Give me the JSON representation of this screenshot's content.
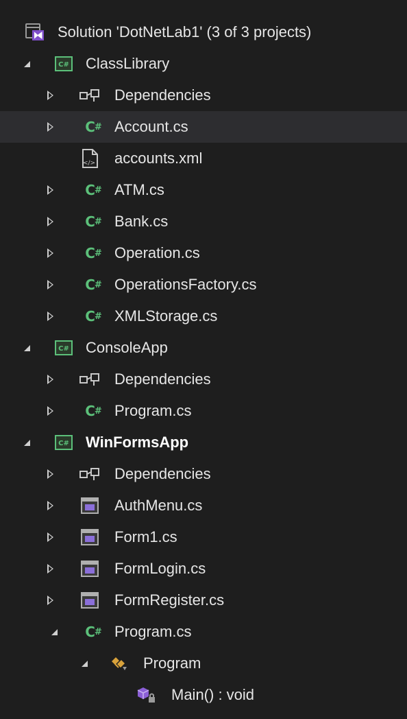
{
  "solution": {
    "label": "Solution 'DotNetLab1' (3 of 3 projects)",
    "icon": "solution-icon"
  },
  "projects": [
    {
      "name": "ClassLibrary",
      "icon": "csharp-project-icon",
      "items": [
        {
          "label": "Dependencies",
          "icon": "dependencies-icon"
        },
        {
          "label": "Account.cs",
          "icon": "csharp-file-icon",
          "selected": true
        },
        {
          "label": "accounts.xml",
          "icon": "xml-file-icon"
        },
        {
          "label": "ATM.cs",
          "icon": "csharp-file-icon"
        },
        {
          "label": "Bank.cs",
          "icon": "csharp-file-icon"
        },
        {
          "label": "Operation.cs",
          "icon": "csharp-file-icon"
        },
        {
          "label": "OperationsFactory.cs",
          "icon": "csharp-file-icon"
        },
        {
          "label": "XMLStorage.cs",
          "icon": "csharp-file-icon"
        }
      ]
    },
    {
      "name": "ConsoleApp",
      "icon": "csharp-project-icon",
      "items": [
        {
          "label": "Dependencies",
          "icon": "dependencies-icon"
        },
        {
          "label": "Program.cs",
          "icon": "csharp-file-icon"
        }
      ]
    },
    {
      "name": "WinFormsApp",
      "icon": "csharp-project-icon",
      "bold": true,
      "items": [
        {
          "label": "Dependencies",
          "icon": "dependencies-icon"
        },
        {
          "label": "AuthMenu.cs",
          "icon": "form-file-icon"
        },
        {
          "label": "Form1.cs",
          "icon": "form-file-icon"
        },
        {
          "label": "FormLogin.cs",
          "icon": "form-file-icon"
        },
        {
          "label": "FormRegister.cs",
          "icon": "form-file-icon"
        },
        {
          "label": "Program.cs",
          "icon": "csharp-file-icon"
        },
        {
          "label": "Program",
          "icon": "class-icon"
        },
        {
          "label": "Main() : void",
          "icon": "method-icon"
        }
      ]
    }
  ],
  "csharp_glyph": "C#",
  "project_glyph": "C#",
  "colors": {
    "background": "#1e1e1e",
    "selected_row": "#2d2d30",
    "csharp_green": "#5cc07a",
    "form_purple": "#8b6fd9",
    "text": "#e6e6e6"
  }
}
